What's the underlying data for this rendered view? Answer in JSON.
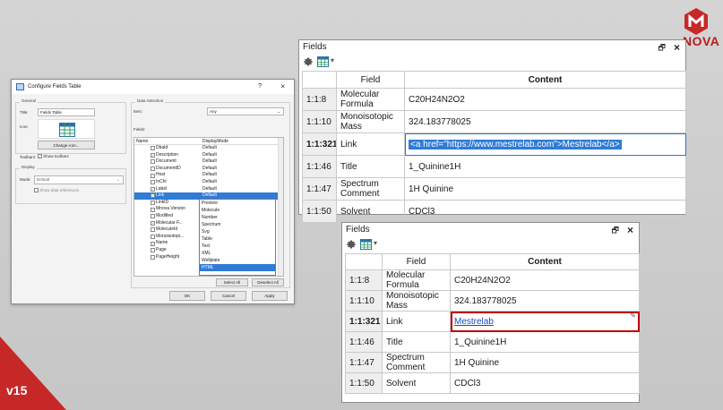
{
  "brand": {
    "name": "NOVA",
    "version": "v15",
    "color": "#c62828"
  },
  "config_dialog": {
    "title": "Configure Fields Table",
    "help": "?",
    "close": "×",
    "general": {
      "label": "General",
      "title_label": "Title:",
      "title_value": "Fields Table",
      "icon_label": "Icon:",
      "change_icon": "Change icon...",
      "toolbars_label": "Toolbars:",
      "show_toolbars": "Show toolbars"
    },
    "display": {
      "label": "Display",
      "mode_label": "Mode:",
      "mode_value": "Default",
      "show_refs": "Show data references"
    },
    "data_selection": {
      "label": "Data Selection",
      "item_label": "Item:",
      "item_value": "Any",
      "fields_label": "Fields:",
      "col_name": "Name",
      "col_mode": "DisplayMode",
      "rows": [
        {
          "name": "DbaId",
          "mode": "Default",
          "checked": false
        },
        {
          "name": "Description",
          "mode": "Default",
          "checked": true
        },
        {
          "name": "Document",
          "mode": "Default",
          "checked": false
        },
        {
          "name": "DocumentID",
          "mode": "Default",
          "checked": false
        },
        {
          "name": "Host",
          "mode": "Default",
          "checked": false
        },
        {
          "name": "InChi",
          "mode": "Default",
          "checked": false
        },
        {
          "name": "Label",
          "mode": "Default",
          "checked": true
        },
        {
          "name": "Link",
          "mode": "Default",
          "checked": true
        },
        {
          "name": "LinkID",
          "mode": "",
          "checked": false
        },
        {
          "name": "Mnova Version",
          "mode": "",
          "checked": false
        },
        {
          "name": "Modified",
          "mode": "",
          "checked": false
        },
        {
          "name": "Molecular F...",
          "mode": "",
          "checked": true
        },
        {
          "name": "MoleculeId",
          "mode": "",
          "checked": false
        },
        {
          "name": "Monoisotopi...",
          "mode": "",
          "checked": false
        },
        {
          "name": "Name",
          "mode": "",
          "checked": true
        },
        {
          "name": "Page",
          "mode": "",
          "checked": false
        },
        {
          "name": "PageHeight",
          "mode": "",
          "checked": false
        }
      ],
      "dropdown_options": [
        "Preview",
        "Molecule",
        "Number",
        "Spectrum",
        "Svg",
        "Table",
        "Text",
        "XML",
        "Wellplate",
        "HTML"
      ],
      "select_all": "Select All",
      "deselect_all": "Deselect All"
    },
    "ok": "OK",
    "cancel": "Cancel",
    "apply": "Apply"
  },
  "panel_top": {
    "title": "Fields",
    "pin": "🗗",
    "close": "×",
    "col_field": "Field",
    "col_content": "Content",
    "rows": [
      {
        "id": "1:1:8",
        "field": "Molecular Formula",
        "content": "C20H24N2O2"
      },
      {
        "id": "1:1:10",
        "field": "Monoisotopic Mass",
        "content": "324.183778025"
      },
      {
        "id": "1:1:321",
        "field": "Link",
        "content": "<a href=\"https://www.mestrelab.com\">Mestrelab</a>"
      },
      {
        "id": "1:1:46",
        "field": "Title",
        "content": "1_Quinine1H"
      },
      {
        "id": "1:1:47",
        "field": "Spectrum Comment",
        "content": "1H Quinine"
      },
      {
        "id": "1:1:50",
        "field": "Solvent",
        "content": "CDCl3"
      }
    ]
  },
  "panel_bottom": {
    "title": "Fields",
    "pin": "🗗",
    "close": "×",
    "col_field": "Field",
    "col_content": "Content",
    "rows": [
      {
        "id": "1:1:8",
        "field": "Molecular Formula",
        "content": "C20H24N2O2"
      },
      {
        "id": "1:1:10",
        "field": "Monoisotopic Mass",
        "content": "324.183778025"
      },
      {
        "id": "1:1:321",
        "field": "Link",
        "content": "Mestrelab"
      },
      {
        "id": "1:1:46",
        "field": "Title",
        "content": "1_Quinine1H"
      },
      {
        "id": "1:1:47",
        "field": "Spectrum Comment",
        "content": "1H Quinine"
      },
      {
        "id": "1:1:50",
        "field": "Solvent",
        "content": "CDCl3"
      }
    ]
  }
}
